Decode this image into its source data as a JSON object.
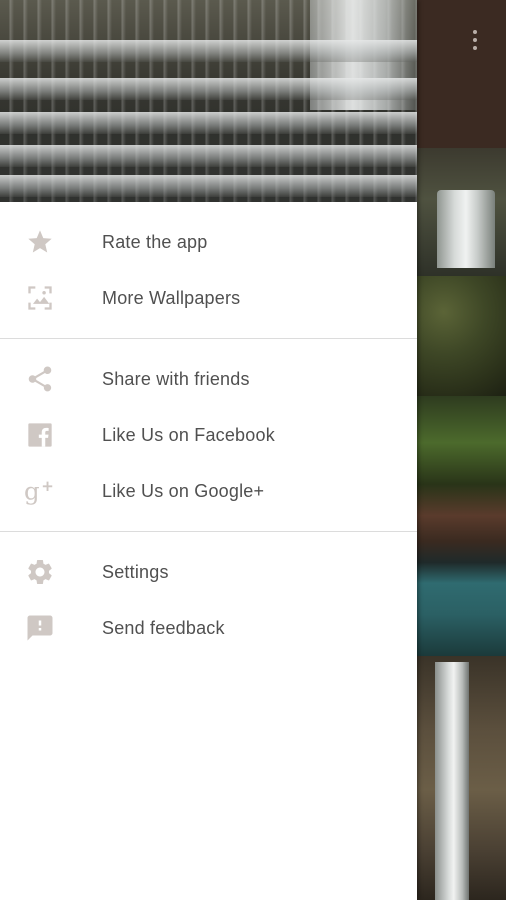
{
  "drawer": {
    "groups": [
      {
        "items": [
          {
            "label": "Rate the app",
            "icon": "star-icon"
          },
          {
            "label": "More Wallpapers",
            "icon": "wallpaper-icon"
          }
        ]
      },
      {
        "items": [
          {
            "label": "Share with friends",
            "icon": "share-icon"
          },
          {
            "label": "Like Us on Facebook",
            "icon": "facebook-icon"
          },
          {
            "label": "Like Us on Google+",
            "icon": "google-plus-icon"
          }
        ]
      },
      {
        "items": [
          {
            "label": "Settings",
            "icon": "gear-icon"
          },
          {
            "label": "Send feedback",
            "icon": "feedback-icon"
          }
        ]
      }
    ]
  },
  "colors": {
    "icon": "#cfc8c4",
    "label": "#505050",
    "divider": "#dcdcdc",
    "toolbar": "#3b2a22"
  }
}
